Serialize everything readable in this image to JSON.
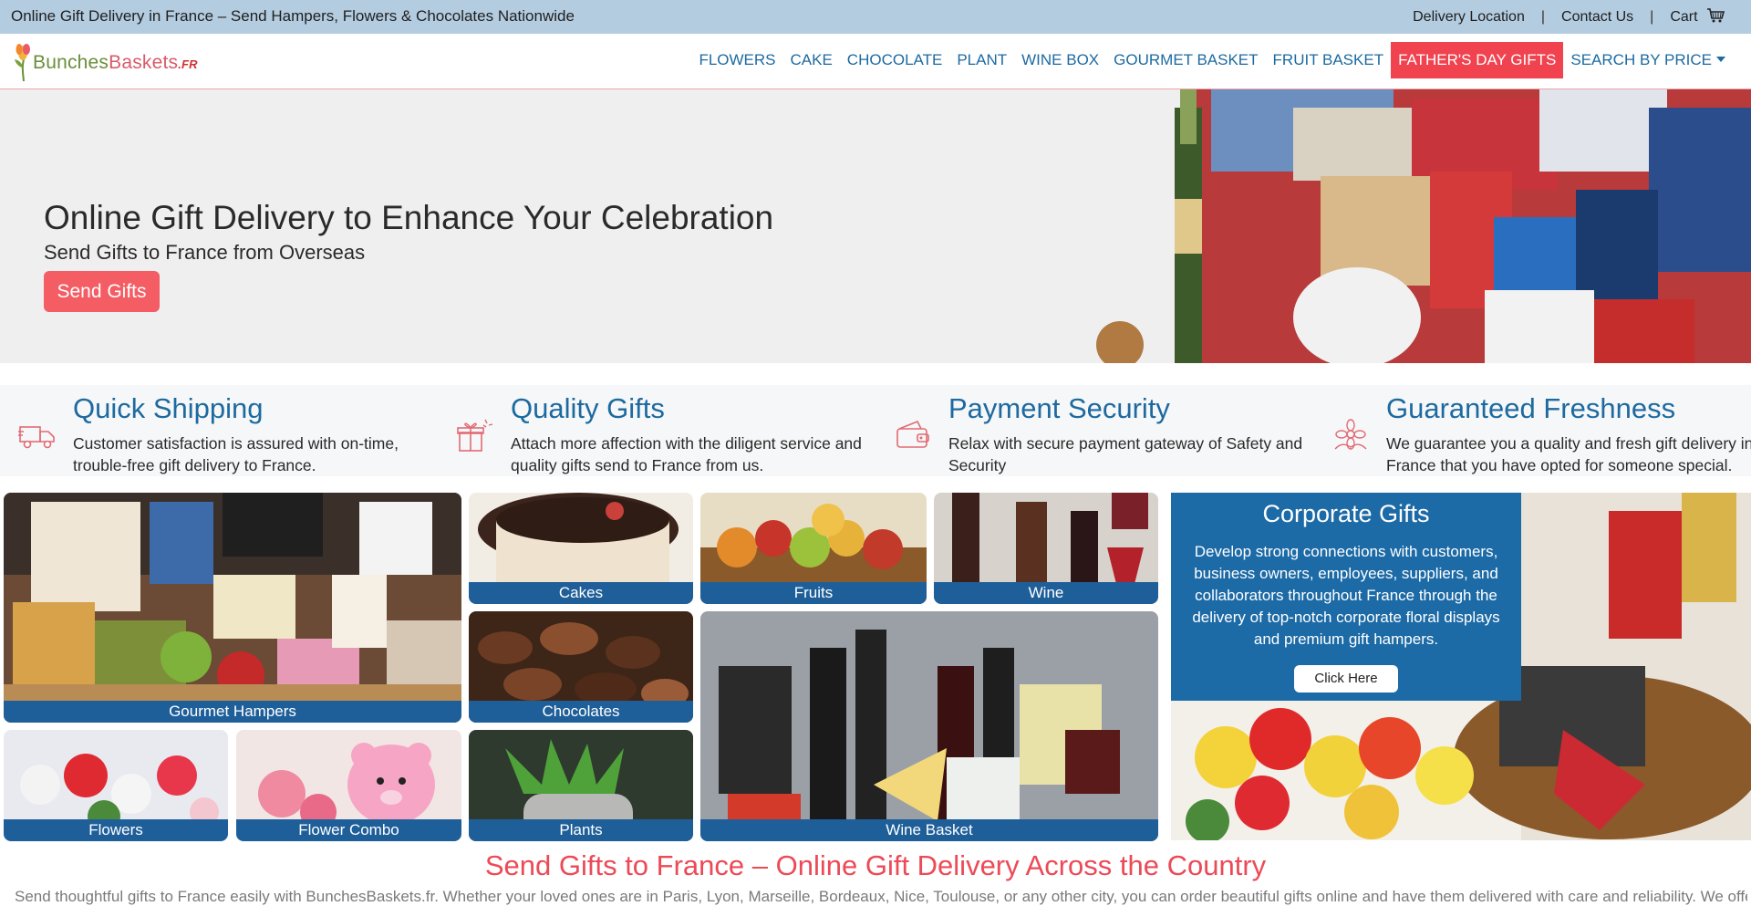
{
  "topbar": {
    "tagline": "Online Gift Delivery in France – Send Hampers, Flowers & Chocolates Nationwide",
    "delivery_location": "Delivery Location",
    "separator": "|",
    "contact_us": "Contact Us",
    "cart": "Cart",
    "cart_icon": "cart-icon"
  },
  "nav": {
    "logo": {
      "part1": "Bunches",
      "part2": "Baskets",
      "part3": ".FR"
    },
    "items": [
      "FLOWERS",
      "CAKE",
      "CHOCOLATE",
      "PLANT",
      "WINE BOX",
      "GOURMET BASKET",
      "FRUIT BASKET",
      "FATHER'S DAY GIFTS",
      "SEARCH BY PRICE"
    ]
  },
  "hero": {
    "title": "Online Gift Delivery to Enhance Your Celebration",
    "subtitle": "Send Gifts to France from Overseas",
    "button": "Send Gifts"
  },
  "features": [
    {
      "icon": "delivery-truck-icon",
      "title": "Quick Shipping",
      "text": "Customer satisfaction is assured with on-time, trouble-free gift delivery to France."
    },
    {
      "icon": "gift-box-icon",
      "title": "Quality Gifts",
      "text": "Attach more affection with the diligent service and quality gifts send to France from us."
    },
    {
      "icon": "wallet-icon",
      "title": "Payment Security",
      "text": "Relax with secure payment gateway of Safety and Security"
    },
    {
      "icon": "flower-icon",
      "title": "Guaranteed Freshness",
      "text": "We guarantee you a quality and fresh gift delivery in France that you have opted for someone special."
    }
  ],
  "tiles": {
    "gourmet_hampers": "Gourmet Hampers",
    "cakes": "Cakes",
    "fruits": "Fruits",
    "wine": "Wine",
    "chocolates": "Chocolates",
    "wine_basket": "Wine Basket",
    "flowers": "Flowers",
    "flower_combo": "Flower Combo",
    "plants": "Plants"
  },
  "corporate": {
    "title": "Corporate Gifts",
    "text": "Develop strong connections with customers, business owners, employees, suppliers, and collaborators throughout France through the delivery of top-notch corporate floral displays and premium gift hampers.",
    "button": "Click Here"
  },
  "bottom": {
    "title": "Send Gifts to France – Online Gift Delivery Across the Country",
    "text": "Send thoughtful gifts to France easily with BunchesBaskets.fr. Whether your loved ones are in Paris, Lyon, Marseille, Bordeaux, Nice, Toulouse, or any other city, you can order beautiful gifts online and have them delivered with care and reliability. We offer a"
  },
  "colors": {
    "topbar_bg": "#b3cce0",
    "nav_link": "#1d6aa0",
    "nav_highlight": "#f0434f",
    "hero_button": "#f35d63",
    "caption_bg": "#1f5f99",
    "corporate_bg": "#1c6aa6",
    "bottom_title": "#ec4a57"
  }
}
